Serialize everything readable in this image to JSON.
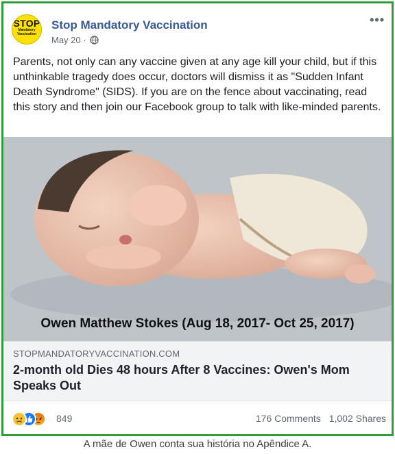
{
  "page": {
    "name": "Stop Mandatory Vaccination",
    "avatar_text": "STOP",
    "avatar_subtext": "Mandatory Vaccination",
    "date": "May 20",
    "separator": "·",
    "more_label": "•••",
    "globe_icon": "globe-icon"
  },
  "post": {
    "text": "Parents, not only can any vaccine given at any age kill your child, but if this unthinkable tragedy does occur, doctors will dismiss it as \"Sudden Infant Death Syndrome\" (SIDS). If you are on the fence about vaccinating, read this story and then join our Facebook group to talk with like-minded parents."
  },
  "photo": {
    "caption": "Owen Matthew Stokes (Aug 18, 2017- Oct 25, 2017)"
  },
  "link": {
    "domain": "STOPMANDATORYVACCINATION.COM",
    "title": "2-month old Dies 48 hours After 8 Vaccines: Owen's Mom Speaks Out"
  },
  "footer": {
    "reaction_icons": [
      "sad-reaction-icon",
      "like-reaction-icon",
      "angry-reaction-icon"
    ],
    "reaction_count": "849",
    "comments": "176 Comments",
    "shares": "1,002 Shares"
  },
  "figure_caption": "A mãe de Owen conta sua história no Apêndice A.",
  "colors": {
    "frame_border": "#2f9e3a",
    "page_name": "#385898",
    "avatar_bg": "#ffe100",
    "link_box_bg": "#f2f3f5"
  }
}
